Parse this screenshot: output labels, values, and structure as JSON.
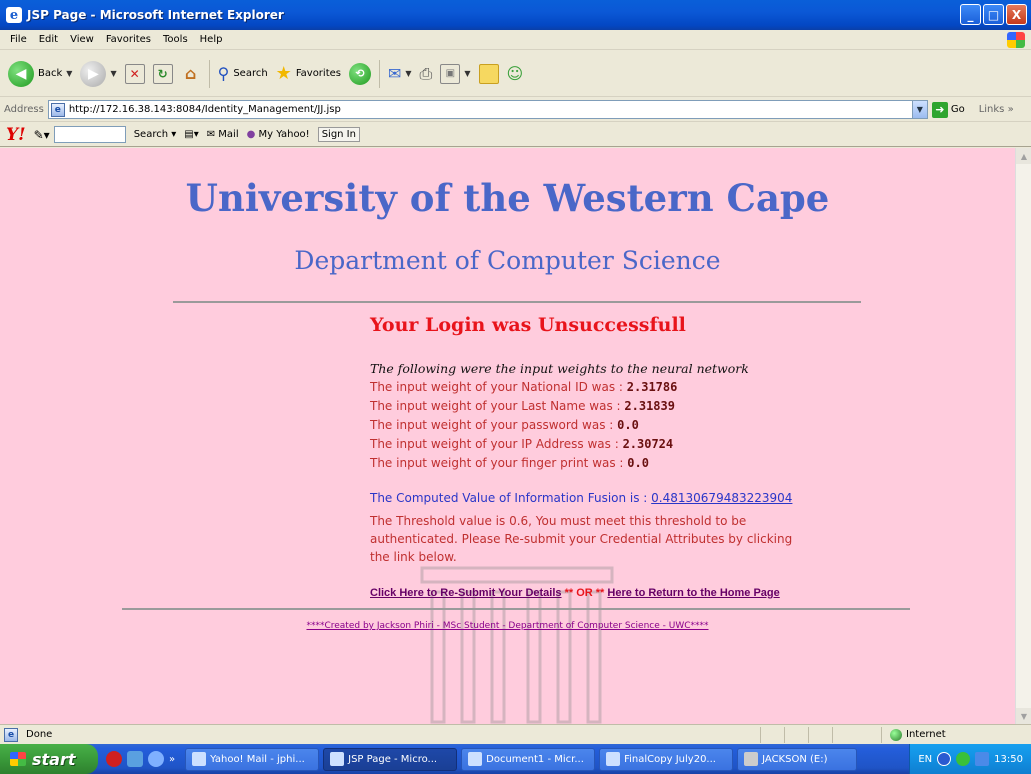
{
  "window": {
    "title": "JSP Page - Microsoft Internet Explorer",
    "buttons": [
      "_",
      "□",
      "X"
    ]
  },
  "menu": [
    "File",
    "Edit",
    "View",
    "Favorites",
    "Tools",
    "Help"
  ],
  "toolbar": {
    "back": "Back",
    "search": "Search",
    "favorites": "Favorites"
  },
  "address": {
    "label": "Address",
    "url": "http://172.16.38.143:8084/Identity_Management/JJ.jsp",
    "go": "Go",
    "links": "Links"
  },
  "yahoo": {
    "logo": "Y!",
    "search": "Search",
    "mail": "Mail",
    "my_yahoo": "My Yahoo!",
    "sign_in": "Sign In"
  },
  "page": {
    "university": "University of the Western Cape",
    "department": "Department of Computer Science",
    "login_message": "Your Login was Unsuccessfull",
    "weights_intro": "The following were the input weights to the neural network",
    "weights": [
      {
        "label": "The input weight of your National ID was : ",
        "value": "2.31786"
      },
      {
        "label": "The input weight of your Last Name was : ",
        "value": "2.31839"
      },
      {
        "label": "The input weight of your password was : ",
        "value": "0.0"
      },
      {
        "label": "The input weight of your IP Address was : ",
        "value": "2.30724"
      },
      {
        "label": "The input weight of your finger print was : ",
        "value": "0.0"
      }
    ],
    "fusion_label": "The Computed Value of Information Fusion is : ",
    "fusion_value": "0.48130679483223904",
    "threshold_text": "The Threshold value is 0.6, You must meet this threshold to be authenticated. Please Re-submit your Credential Attributes by clicking the link below.",
    "resubmit_link": "Click Here to Re-Submit Your Details",
    "or_text": " ** OR ** ",
    "home_link": "Here to Return to the Home Page",
    "credit": "****Created by Jackson Phiri - MSc Student - Department of Computer Science - UWC****"
  },
  "status": {
    "text": "Done",
    "zone": "Internet"
  },
  "taskbar": {
    "start": "start",
    "tasks": [
      {
        "label": "Yahoo! Mail - jphi...",
        "active": false
      },
      {
        "label": "JSP Page - Micro...",
        "active": true
      },
      {
        "label": "Document1 - Micr...",
        "active": false
      },
      {
        "label": "FinalCopy July20...",
        "active": false
      },
      {
        "label": "JACKSON (E:)",
        "active": false
      }
    ],
    "lang": "EN",
    "clock": "13:50"
  }
}
